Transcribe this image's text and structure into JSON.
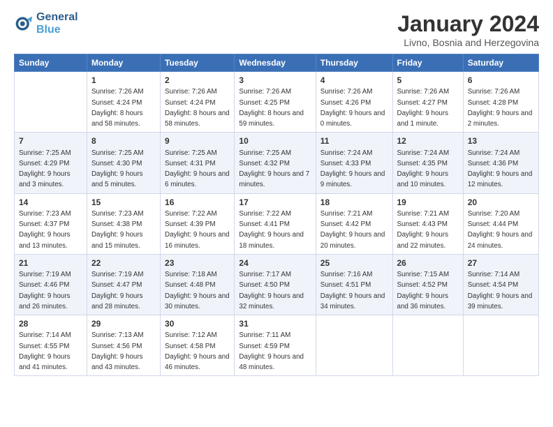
{
  "logo": {
    "line1": "General",
    "line2": "Blue"
  },
  "title": "January 2024",
  "location": "Livno, Bosnia and Herzegovina",
  "weekdays": [
    "Sunday",
    "Monday",
    "Tuesday",
    "Wednesday",
    "Thursday",
    "Friday",
    "Saturday"
  ],
  "rows": [
    [
      {
        "day": "",
        "sunrise": "",
        "sunset": "",
        "daylight": ""
      },
      {
        "day": "1",
        "sunrise": "Sunrise: 7:26 AM",
        "sunset": "Sunset: 4:24 PM",
        "daylight": "Daylight: 8 hours and 58 minutes."
      },
      {
        "day": "2",
        "sunrise": "Sunrise: 7:26 AM",
        "sunset": "Sunset: 4:24 PM",
        "daylight": "Daylight: 8 hours and 58 minutes."
      },
      {
        "day": "3",
        "sunrise": "Sunrise: 7:26 AM",
        "sunset": "Sunset: 4:25 PM",
        "daylight": "Daylight: 8 hours and 59 minutes."
      },
      {
        "day": "4",
        "sunrise": "Sunrise: 7:26 AM",
        "sunset": "Sunset: 4:26 PM",
        "daylight": "Daylight: 9 hours and 0 minutes."
      },
      {
        "day": "5",
        "sunrise": "Sunrise: 7:26 AM",
        "sunset": "Sunset: 4:27 PM",
        "daylight": "Daylight: 9 hours and 1 minute."
      },
      {
        "day": "6",
        "sunrise": "Sunrise: 7:26 AM",
        "sunset": "Sunset: 4:28 PM",
        "daylight": "Daylight: 9 hours and 2 minutes."
      }
    ],
    [
      {
        "day": "7",
        "sunrise": "Sunrise: 7:25 AM",
        "sunset": "Sunset: 4:29 PM",
        "daylight": "Daylight: 9 hours and 3 minutes."
      },
      {
        "day": "8",
        "sunrise": "Sunrise: 7:25 AM",
        "sunset": "Sunset: 4:30 PM",
        "daylight": "Daylight: 9 hours and 5 minutes."
      },
      {
        "day": "9",
        "sunrise": "Sunrise: 7:25 AM",
        "sunset": "Sunset: 4:31 PM",
        "daylight": "Daylight: 9 hours and 6 minutes."
      },
      {
        "day": "10",
        "sunrise": "Sunrise: 7:25 AM",
        "sunset": "Sunset: 4:32 PM",
        "daylight": "Daylight: 9 hours and 7 minutes."
      },
      {
        "day": "11",
        "sunrise": "Sunrise: 7:24 AM",
        "sunset": "Sunset: 4:33 PM",
        "daylight": "Daylight: 9 hours and 9 minutes."
      },
      {
        "day": "12",
        "sunrise": "Sunrise: 7:24 AM",
        "sunset": "Sunset: 4:35 PM",
        "daylight": "Daylight: 9 hours and 10 minutes."
      },
      {
        "day": "13",
        "sunrise": "Sunrise: 7:24 AM",
        "sunset": "Sunset: 4:36 PM",
        "daylight": "Daylight: 9 hours and 12 minutes."
      }
    ],
    [
      {
        "day": "14",
        "sunrise": "Sunrise: 7:23 AM",
        "sunset": "Sunset: 4:37 PM",
        "daylight": "Daylight: 9 hours and 13 minutes."
      },
      {
        "day": "15",
        "sunrise": "Sunrise: 7:23 AM",
        "sunset": "Sunset: 4:38 PM",
        "daylight": "Daylight: 9 hours and 15 minutes."
      },
      {
        "day": "16",
        "sunrise": "Sunrise: 7:22 AM",
        "sunset": "Sunset: 4:39 PM",
        "daylight": "Daylight: 9 hours and 16 minutes."
      },
      {
        "day": "17",
        "sunrise": "Sunrise: 7:22 AM",
        "sunset": "Sunset: 4:41 PM",
        "daylight": "Daylight: 9 hours and 18 minutes."
      },
      {
        "day": "18",
        "sunrise": "Sunrise: 7:21 AM",
        "sunset": "Sunset: 4:42 PM",
        "daylight": "Daylight: 9 hours and 20 minutes."
      },
      {
        "day": "19",
        "sunrise": "Sunrise: 7:21 AM",
        "sunset": "Sunset: 4:43 PM",
        "daylight": "Daylight: 9 hours and 22 minutes."
      },
      {
        "day": "20",
        "sunrise": "Sunrise: 7:20 AM",
        "sunset": "Sunset: 4:44 PM",
        "daylight": "Daylight: 9 hours and 24 minutes."
      }
    ],
    [
      {
        "day": "21",
        "sunrise": "Sunrise: 7:19 AM",
        "sunset": "Sunset: 4:46 PM",
        "daylight": "Daylight: 9 hours and 26 minutes."
      },
      {
        "day": "22",
        "sunrise": "Sunrise: 7:19 AM",
        "sunset": "Sunset: 4:47 PM",
        "daylight": "Daylight: 9 hours and 28 minutes."
      },
      {
        "day": "23",
        "sunrise": "Sunrise: 7:18 AM",
        "sunset": "Sunset: 4:48 PM",
        "daylight": "Daylight: 9 hours and 30 minutes."
      },
      {
        "day": "24",
        "sunrise": "Sunrise: 7:17 AM",
        "sunset": "Sunset: 4:50 PM",
        "daylight": "Daylight: 9 hours and 32 minutes."
      },
      {
        "day": "25",
        "sunrise": "Sunrise: 7:16 AM",
        "sunset": "Sunset: 4:51 PM",
        "daylight": "Daylight: 9 hours and 34 minutes."
      },
      {
        "day": "26",
        "sunrise": "Sunrise: 7:15 AM",
        "sunset": "Sunset: 4:52 PM",
        "daylight": "Daylight: 9 hours and 36 minutes."
      },
      {
        "day": "27",
        "sunrise": "Sunrise: 7:14 AM",
        "sunset": "Sunset: 4:54 PM",
        "daylight": "Daylight: 9 hours and 39 minutes."
      }
    ],
    [
      {
        "day": "28",
        "sunrise": "Sunrise: 7:14 AM",
        "sunset": "Sunset: 4:55 PM",
        "daylight": "Daylight: 9 hours and 41 minutes."
      },
      {
        "day": "29",
        "sunrise": "Sunrise: 7:13 AM",
        "sunset": "Sunset: 4:56 PM",
        "daylight": "Daylight: 9 hours and 43 minutes."
      },
      {
        "day": "30",
        "sunrise": "Sunrise: 7:12 AM",
        "sunset": "Sunset: 4:58 PM",
        "daylight": "Daylight: 9 hours and 46 minutes."
      },
      {
        "day": "31",
        "sunrise": "Sunrise: 7:11 AM",
        "sunset": "Sunset: 4:59 PM",
        "daylight": "Daylight: 9 hours and 48 minutes."
      },
      {
        "day": "",
        "sunrise": "",
        "sunset": "",
        "daylight": ""
      },
      {
        "day": "",
        "sunrise": "",
        "sunset": "",
        "daylight": ""
      },
      {
        "day": "",
        "sunrise": "",
        "sunset": "",
        "daylight": ""
      }
    ]
  ]
}
